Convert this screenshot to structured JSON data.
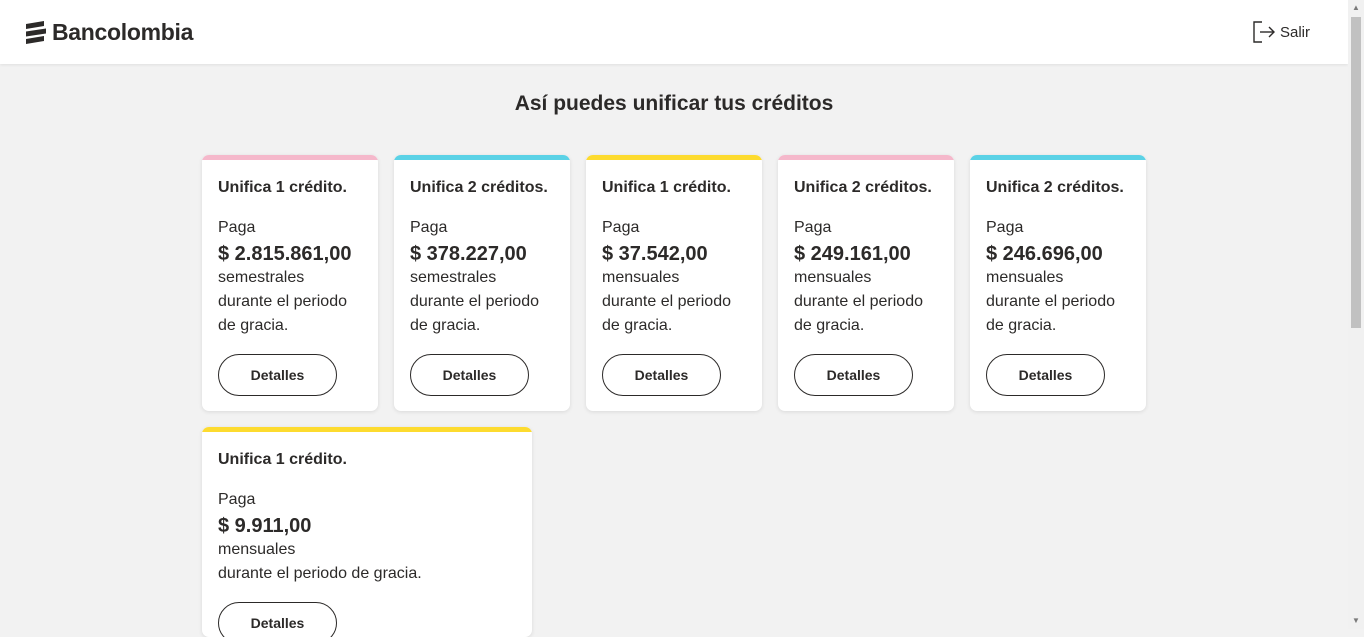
{
  "header": {
    "brand": "Bancolombia",
    "logout_label": "Salir"
  },
  "title": "Así puedes unificar tus créditos",
  "colors": {
    "pink": "#f5b8cb",
    "cyan": "#5bd2e6",
    "yellow": "#fddb2f",
    "text": "#2c2a29",
    "background": "#f2f2f2"
  },
  "cards": [
    {
      "title": "Unifica 1 crédito.",
      "pay_label": "Paga",
      "amount": "$ 2.815.861,00",
      "frequency": "semestrales",
      "grace_1": "durante el periodo",
      "grace_2": "de gracia.",
      "button": "Detalles",
      "accent": "pink"
    },
    {
      "title": "Unifica 2 créditos.",
      "pay_label": "Paga",
      "amount": "$ 378.227,00",
      "frequency": "semestrales",
      "grace_1": "durante el periodo",
      "grace_2": "de gracia.",
      "button": "Detalles",
      "accent": "cyan"
    },
    {
      "title": "Unifica 1 crédito.",
      "pay_label": "Paga",
      "amount": "$ 37.542,00",
      "frequency": "mensuales",
      "grace_1": "durante el periodo",
      "grace_2": "de gracia.",
      "button": "Detalles",
      "accent": "yellow"
    },
    {
      "title": "Unifica 2 créditos.",
      "pay_label": "Paga",
      "amount": "$ 249.161,00",
      "frequency": "mensuales",
      "grace_1": "durante el periodo",
      "grace_2": "de gracia.",
      "button": "Detalles",
      "accent": "pink"
    },
    {
      "title": "Unifica 2 créditos.",
      "pay_label": "Paga",
      "amount": "$ 246.696,00",
      "frequency": "mensuales",
      "grace_1": "durante el periodo",
      "grace_2": "de gracia.",
      "button": "Detalles",
      "accent": "cyan"
    },
    {
      "title": "Unifica 1 crédito.",
      "pay_label": "Paga",
      "amount": "$ 9.911,00",
      "frequency": "mensuales",
      "grace_1": "durante el periodo de gracia.",
      "grace_2": "",
      "button": "Detalles",
      "accent": "yellow"
    }
  ]
}
